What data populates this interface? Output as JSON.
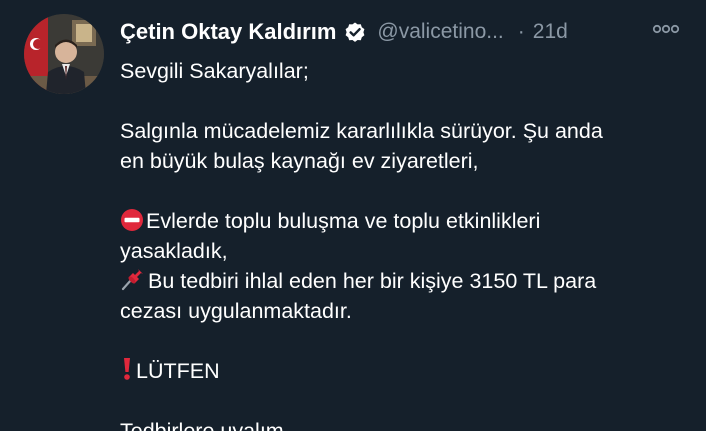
{
  "tweet": {
    "display_name": "Çetin Oktay Kaldırım",
    "handle": "@valicetino...",
    "separator": "·",
    "time": "21d",
    "verified": true,
    "lines": {
      "l1": "Sevgili Sakaryalılar;",
      "l2": "Salgınla mücadelemiz kararlılıkla sürüyor. Şu anda",
      "l3": "en büyük bulaş kaynağı ev ziyaretleri,",
      "l4": "Evlerde toplu buluşma ve toplu etkinlikleri",
      "l5": "yasakladık,",
      "l6": "Bu tedbiri ihlal eden her bir kişiye 3150 TL para",
      "l7": "cezası uygulanmaktadır.",
      "l8": "LÜTFEN",
      "l9": "Tedbirlere uyalım..."
    },
    "icons": {
      "verified": "verified-badge-icon",
      "more": "more-options-icon",
      "no_entry": "no-entry-emoji-icon",
      "pushpin": "pushpin-emoji-icon",
      "exclamation": "exclamation-emoji-icon"
    },
    "colors": {
      "background": "#15202b",
      "text": "#ffffff",
      "muted": "#8b98a5",
      "no_entry": "#e0283c",
      "pushpin": "#e0283c",
      "exclamation": "#e0283c"
    }
  }
}
